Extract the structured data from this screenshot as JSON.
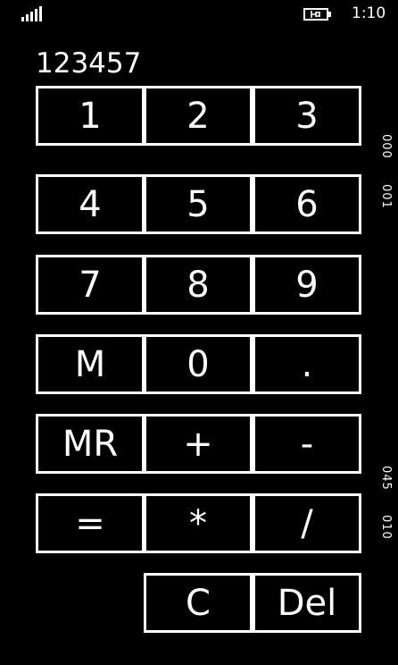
{
  "status_bar": {
    "time": "1:10",
    "signal_icon": "signal-bars-icon",
    "battery_icon": "battery-charging-icon"
  },
  "display": {
    "value": "123457"
  },
  "keys": {
    "one": "1",
    "two": "2",
    "three": "3",
    "four": "4",
    "five": "5",
    "six": "6",
    "seven": "7",
    "eight": "8",
    "nine": "9",
    "memory": "M",
    "zero": "0",
    "decimal": ".",
    "memory_recall": "MR",
    "plus": "+",
    "minus": "-",
    "equals": "=",
    "multiply": "*",
    "divide": "/",
    "clear": "C",
    "delete": "Del"
  },
  "side_labels": {
    "label_a": "000",
    "label_b": "001",
    "label_c": "045",
    "label_d": "010"
  },
  "colors": {
    "background": "#000000",
    "foreground": "#ffffff"
  }
}
